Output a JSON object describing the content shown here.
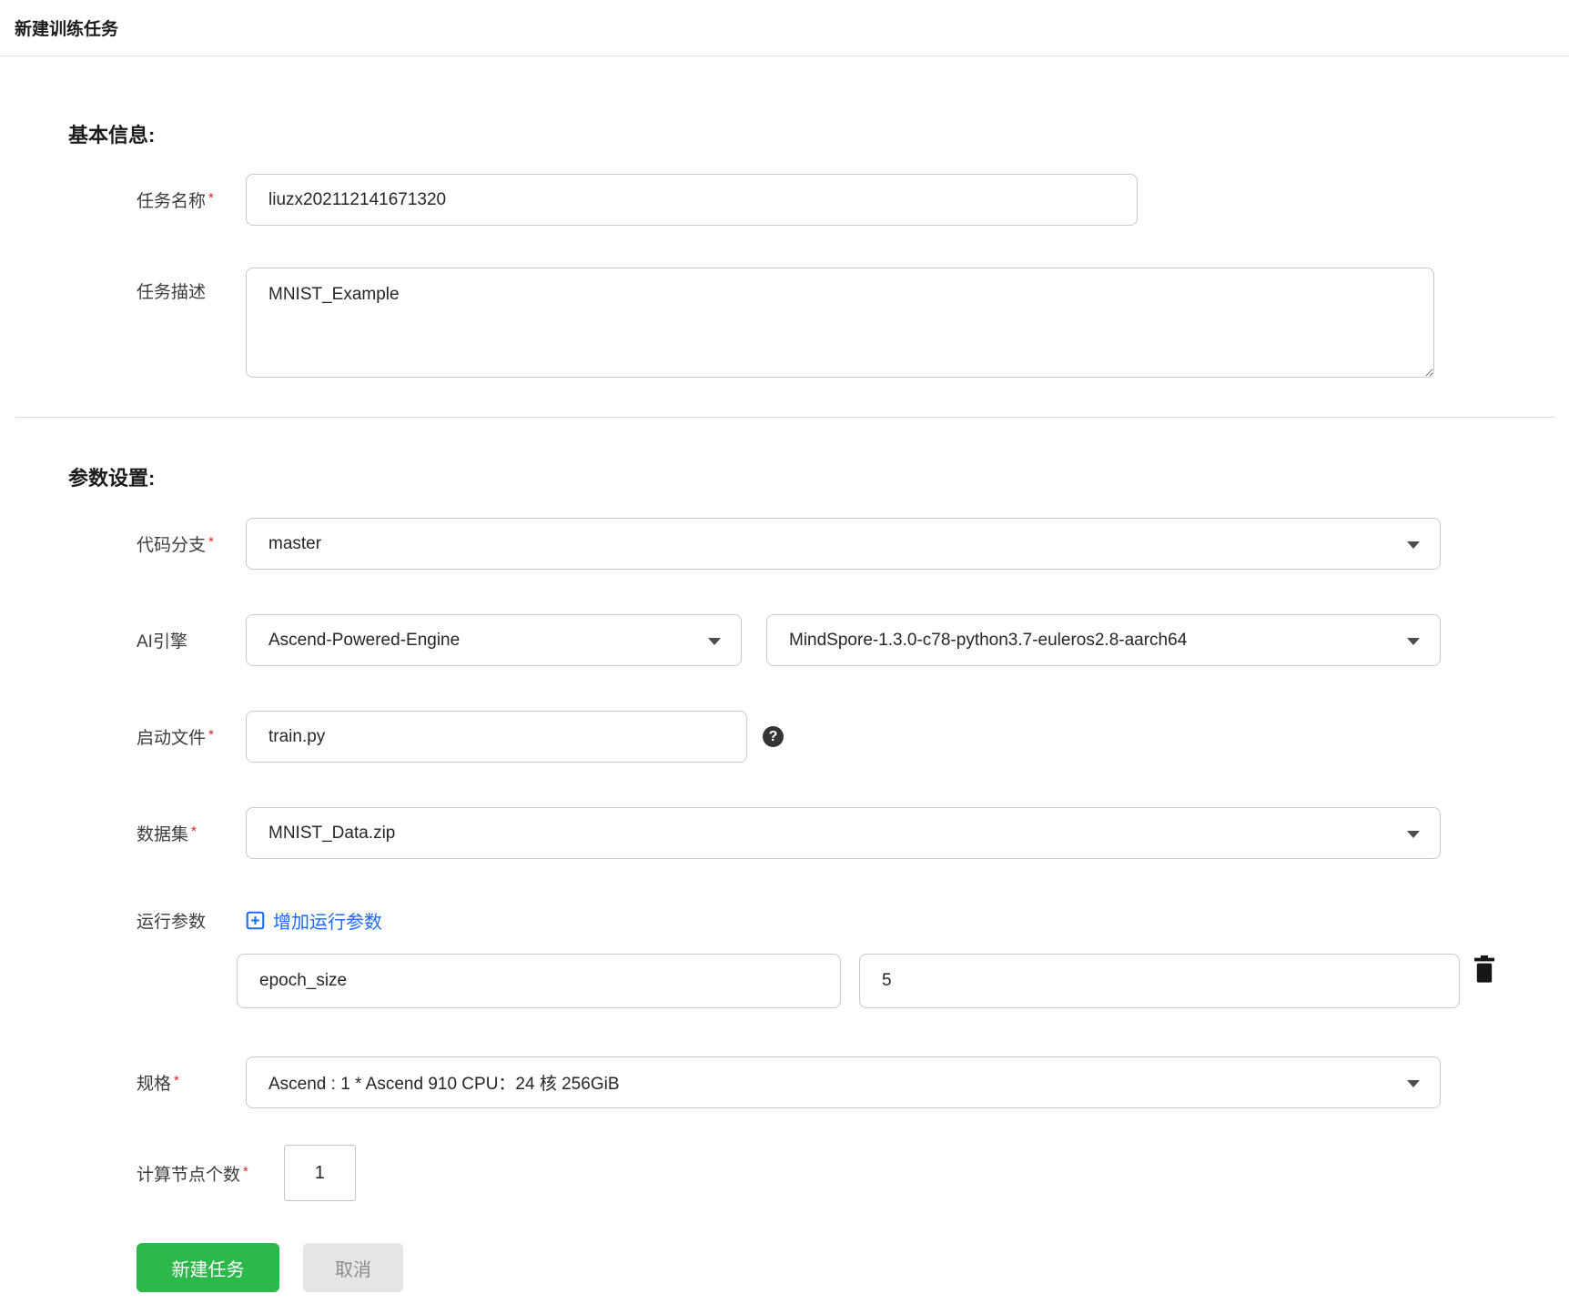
{
  "header": {
    "title": "新建训练任务"
  },
  "sections": {
    "basic_heading": "基本信息:",
    "params_heading": "参数设置:"
  },
  "misc": {
    "required_marker": "*"
  },
  "fields": {
    "task_name": {
      "label": "任务名称",
      "required": true,
      "value": "liuzx202112141671320"
    },
    "task_desc": {
      "label": "任务描述",
      "required": false,
      "value": "MNIST_Example"
    },
    "code_branch": {
      "label": "代码分支",
      "required": true,
      "value": "master"
    },
    "ai_engine": {
      "label": "AI引擎",
      "engine_value": "Ascend-Powered-Engine",
      "version_value": "MindSpore-1.3.0-c78-python3.7-euleros2.8-aarch64"
    },
    "boot_file": {
      "label": "启动文件",
      "required": true,
      "value": "train.py"
    },
    "dataset": {
      "label": "数据集",
      "required": true,
      "value": "MNIST_Data.zip"
    },
    "run_params": {
      "label": "运行参数",
      "add_link_label": "增加运行参数",
      "entries": [
        {
          "key": "epoch_size",
          "value": "5"
        }
      ]
    },
    "spec": {
      "label": "规格",
      "required": true,
      "value": "Ascend : 1 * Ascend 910 CPU：24 核 256GiB"
    },
    "node_count": {
      "label": "计算节点个数",
      "required": true,
      "value": "1"
    }
  },
  "buttons": {
    "create": "新建任务",
    "cancel": "取消"
  },
  "icons": {
    "help_glyph": "?",
    "add_param_icon": "squared-plus",
    "delete_icon": "trash",
    "dropdown_icon": "caret-down",
    "help_icon": "question-circle"
  },
  "colors": {
    "accent_green": "#2db84b",
    "link_blue": "#1e6bf0",
    "required_red": "#e02424",
    "border_gray": "#c9c9c9"
  }
}
